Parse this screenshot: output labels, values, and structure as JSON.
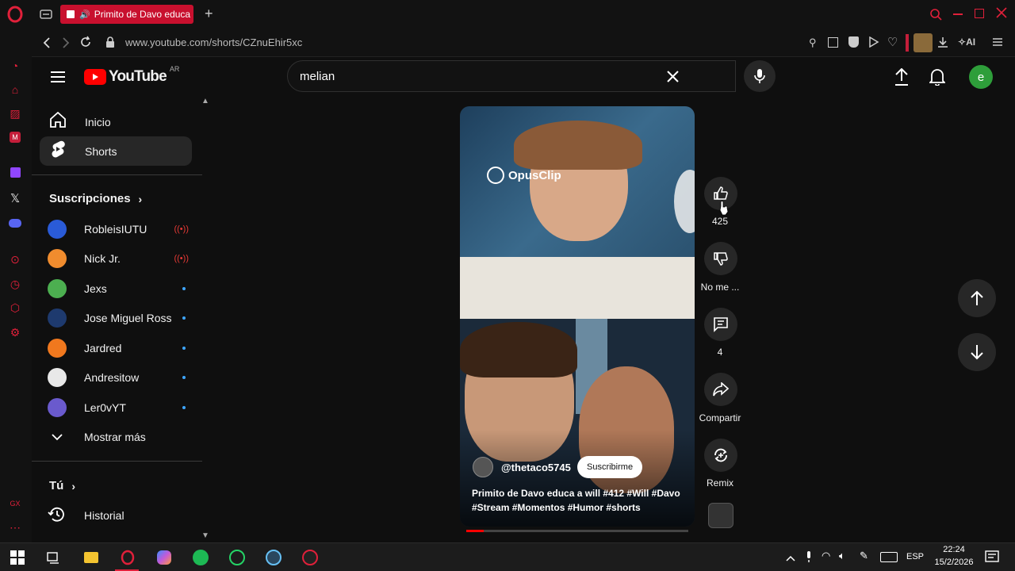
{
  "browser": {
    "tab_title": "Primito de Davo educa",
    "new_tab": "+",
    "url": "www.youtube.com/shorts/CZnuEhir5xc",
    "ai_label": "AI"
  },
  "youtube": {
    "logo_text": "YouTube",
    "logo_region": "AR",
    "search_value": "melian",
    "avatar_letter": "e",
    "nav": [
      {
        "label": "Inicio"
      },
      {
        "label": "Shorts"
      }
    ],
    "subscriptions_title": "Suscripciones",
    "subscriptions": [
      {
        "name": "RobleisIUTU",
        "status": "live",
        "color": "#2a5bd7"
      },
      {
        "name": "Nick Jr.",
        "status": "live",
        "color": "#f08c2e"
      },
      {
        "name": "Jexs",
        "status": "new",
        "color": "#4caf50"
      },
      {
        "name": "Jose Miguel Ross",
        "status": "new",
        "color": "#1e3a6e"
      },
      {
        "name": "Jardred",
        "status": "new",
        "color": "#f0781e"
      },
      {
        "name": "Andresitow",
        "status": "new",
        "color": "#e8e8e8"
      },
      {
        "name": "Ler0vYT",
        "status": "new",
        "color": "#6a5acd"
      }
    ],
    "show_more": "Mostrar más",
    "you_title": "Tú",
    "history": "Historial"
  },
  "short": {
    "watermark": "OpusClip",
    "channel": "@thetaco5745",
    "subscribe": "Suscribirme",
    "caption": "Primito de Davo educa a will #412 #Will #Davo #Stream #Momentos #Humor #shorts",
    "progress": 0.08,
    "likes": "425",
    "dislike_label": "No me ...",
    "comments": "4",
    "share_label": "Compartir",
    "remix_label": "Remix"
  },
  "taskbar": {
    "language": "ESP",
    "time": "22:24",
    "date": "15/2/2026"
  }
}
